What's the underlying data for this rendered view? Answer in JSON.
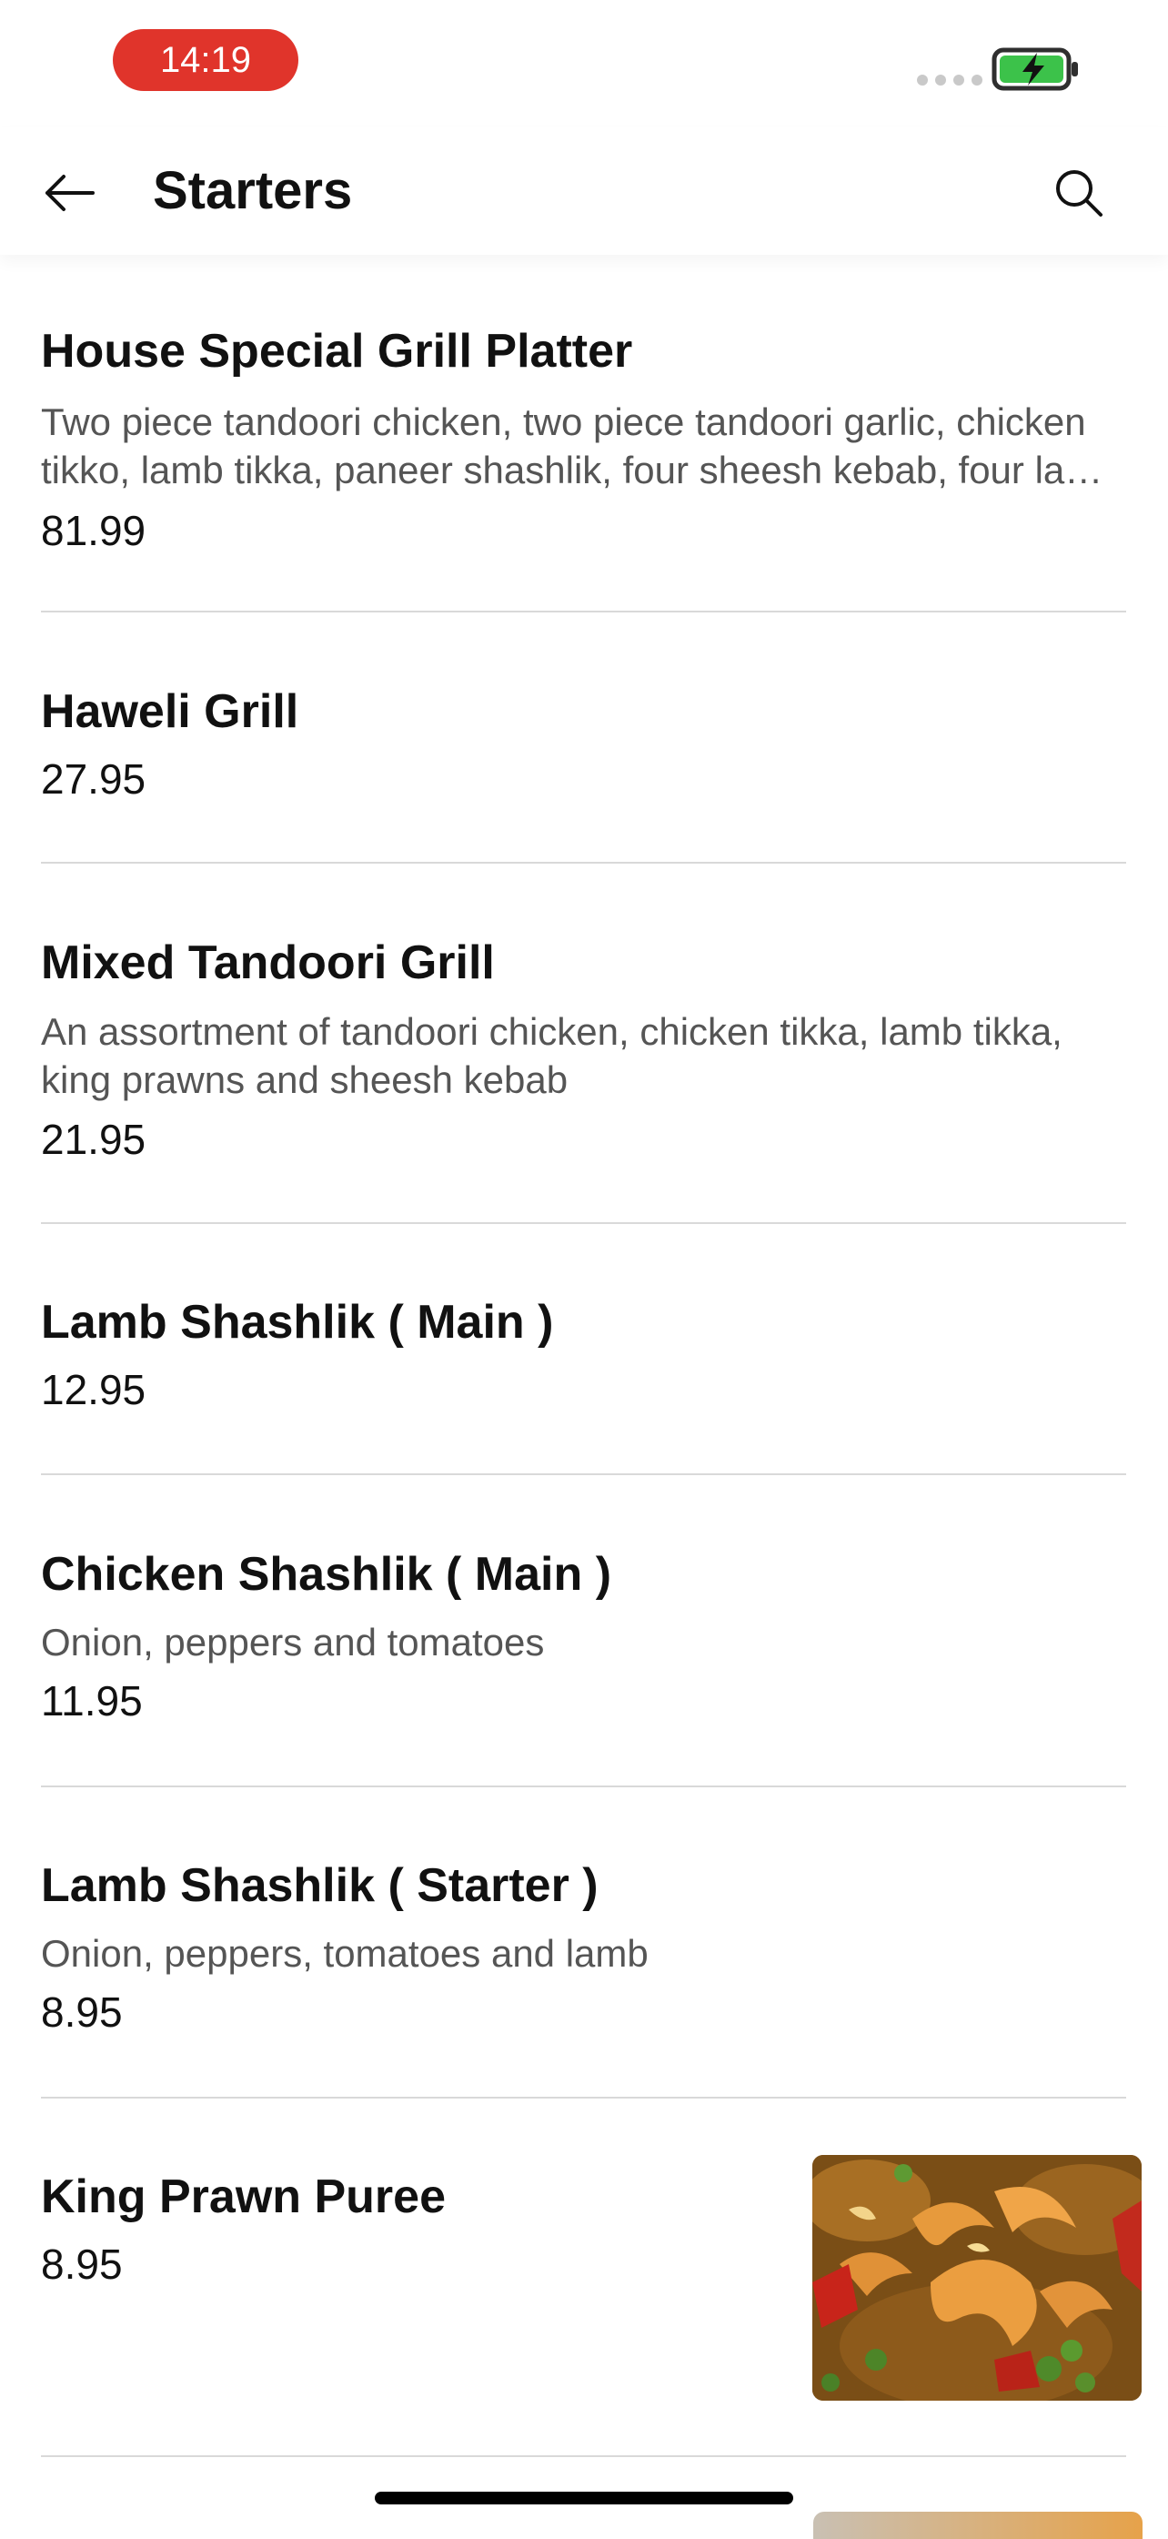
{
  "status": {
    "time": "14:19"
  },
  "header": {
    "title": "Starters"
  },
  "colors": {
    "accent": "#e0342b",
    "battery": "#3cc24a"
  },
  "icons": {
    "back": "arrow-left-icon",
    "search": "search-icon"
  },
  "items": [
    {
      "name": "House Special Grill Platter",
      "desc_line1": "Two piece tandoori chicken, two piece tandoori garlic, chicken",
      "desc_line2": "tikko, lamb tikka, paneer shashlik, four sheesh kebab, four la…",
      "price": "81.99"
    },
    {
      "name": "Haweli Grill",
      "price": "27.95"
    },
    {
      "name": "Mixed Tandoori Grill",
      "desc_line1": "An assortment of tandoori chicken, chicken tikka, lamb tikka,",
      "desc_line2": "king prawns and sheesh kebab",
      "price": "21.95"
    },
    {
      "name": "Lamb Shashlik ( Main )",
      "price": "12.95"
    },
    {
      "name": "Chicken Shashlik ( Main )",
      "desc_line1": "Onion, peppers and tomatoes",
      "price": "11.95"
    },
    {
      "name": "Lamb Shashlik ( Starter )",
      "desc_line1": "Onion, peppers, tomatoes and lamb",
      "price": "8.95"
    },
    {
      "name": "King Prawn Puree",
      "price": "8.95"
    }
  ]
}
